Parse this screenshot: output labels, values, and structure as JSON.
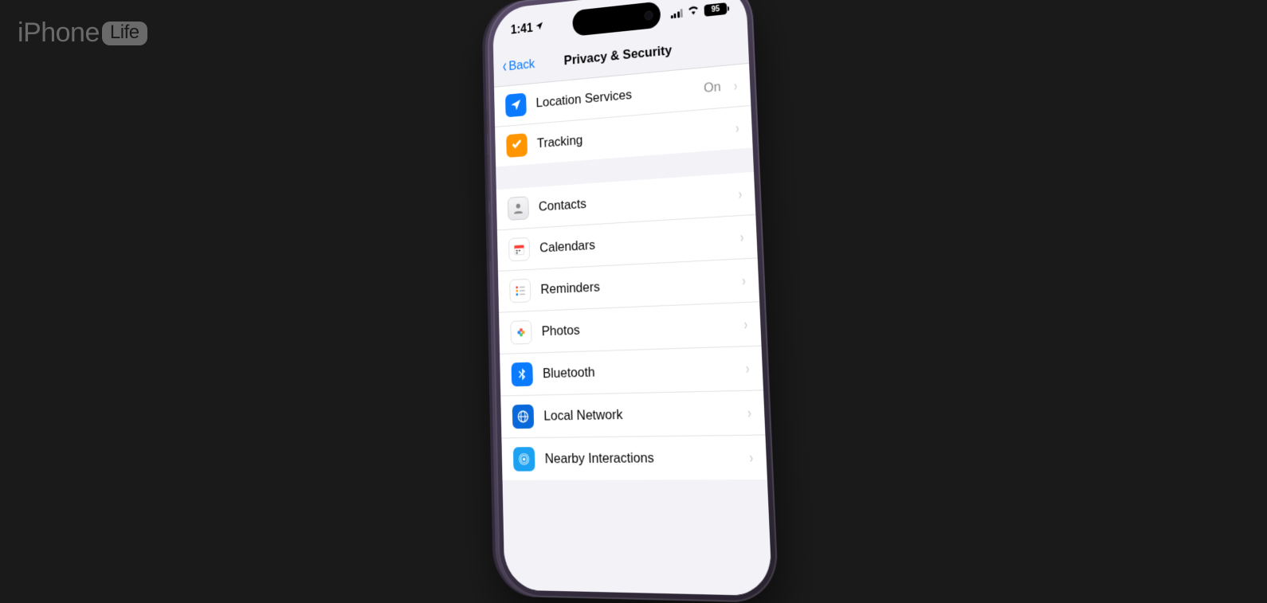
{
  "logo": {
    "brand": "iPhone",
    "box": "Life"
  },
  "status": {
    "time": "1:41",
    "battery": "95"
  },
  "nav": {
    "back": "Back",
    "title": "Privacy & Security"
  },
  "group1": [
    {
      "label": "Location Services",
      "value": "On"
    },
    {
      "label": "Tracking",
      "value": ""
    }
  ],
  "group2": [
    {
      "label": "Contacts"
    },
    {
      "label": "Calendars"
    },
    {
      "label": "Reminders"
    },
    {
      "label": "Photos"
    },
    {
      "label": "Bluetooth"
    },
    {
      "label": "Local Network"
    },
    {
      "label": "Nearby Interactions"
    }
  ]
}
